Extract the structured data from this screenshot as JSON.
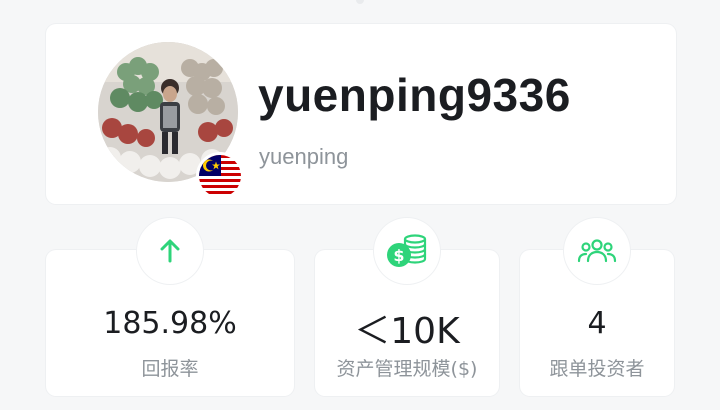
{
  "profile": {
    "username": "yuenping9336",
    "handle": "yuenping",
    "avatar": "profile-photo",
    "country_flag": "malaysia-flag"
  },
  "stats": [
    {
      "icon": "arrow-up-icon",
      "value": "185.98%",
      "label": "回报率"
    },
    {
      "icon": "coin-stack-icon",
      "value": "＜10K",
      "label": "资产管理规模($)"
    },
    {
      "icon": "people-group-icon",
      "value": "4",
      "label": "跟单投资者"
    }
  ],
  "colors": {
    "accent": "#2ed47a",
    "text_primary": "#1b1d21",
    "text_secondary": "#8e949a",
    "card_bg": "#ffffff",
    "page_bg": "#f6f7f8"
  }
}
